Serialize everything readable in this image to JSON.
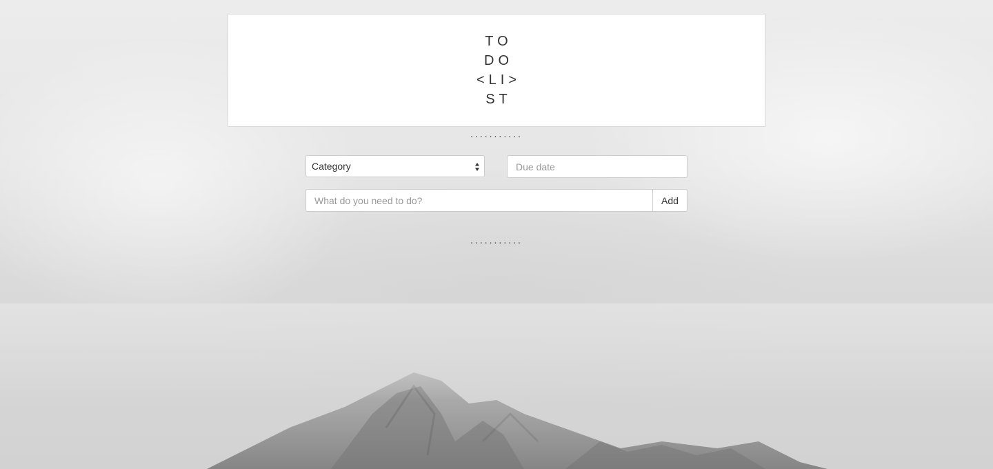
{
  "header": {
    "logo_lines": [
      "TO",
      "DO",
      "<LI>",
      "ST"
    ]
  },
  "separator": "...........",
  "form": {
    "category_value": "Category",
    "due_date_placeholder": "Due date",
    "task_placeholder": "What do you need to do?",
    "add_label": "Add"
  },
  "icons": {
    "select": "select-updown-arrows-icon"
  }
}
